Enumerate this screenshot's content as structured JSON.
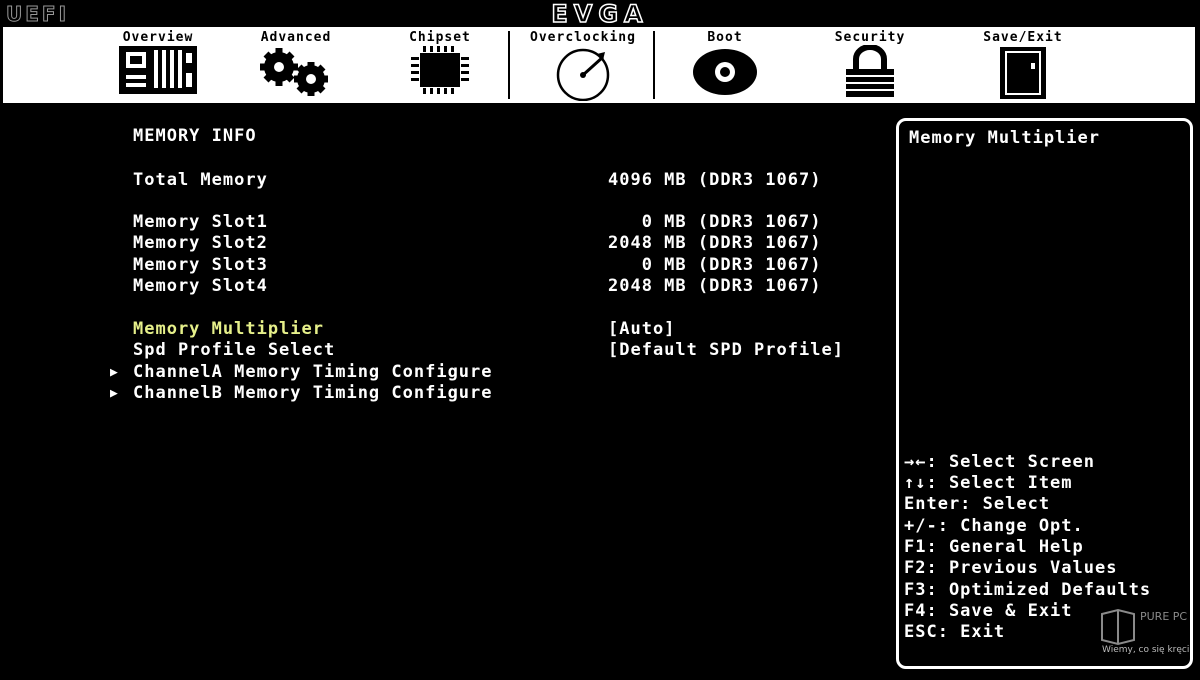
{
  "header": {
    "uefi_label": "UEFI",
    "brand": "EVGA"
  },
  "tabs": [
    {
      "label": "Overview",
      "icon": "motherboard-icon"
    },
    {
      "label": "Advanced",
      "icon": "gears-icon"
    },
    {
      "label": "Chipset",
      "icon": "chip-icon"
    },
    {
      "label": "Overclocking",
      "icon": "gauge-icon",
      "selected": true
    },
    {
      "label": "Boot",
      "icon": "disc-icon"
    },
    {
      "label": "Security",
      "icon": "padlock-icon"
    },
    {
      "label": "Save/Exit",
      "icon": "door-icon"
    }
  ],
  "main": {
    "section_title": "MEMORY INFO",
    "total_memory": {
      "label": "Total Memory",
      "value": "4096 MB (DDR3 1067)"
    },
    "slots": [
      {
        "label": "Memory Slot1",
        "value": "   0 MB (DDR3 1067)"
      },
      {
        "label": "Memory Slot2",
        "value": "2048 MB (DDR3 1067)"
      },
      {
        "label": "Memory Slot3",
        "value": "   0 MB (DDR3 1067)"
      },
      {
        "label": "Memory Slot4",
        "value": "2048 MB (DDR3 1067)"
      }
    ],
    "options": [
      {
        "label": "Memory Multiplier",
        "value": "[Auto]"
      },
      {
        "label": "Spd Profile Select",
        "value": "[Default SPD Profile]"
      },
      {
        "label": "ChannelA Memory Timing Configure"
      },
      {
        "label": "ChannelB Memory Timing Configure"
      }
    ]
  },
  "help": {
    "title": "Memory Multiplier",
    "lines": [
      "→←: Select Screen",
      "↑↓: Select Item",
      "Enter: Select",
      "+/-: Change Opt.",
      "F1: General Help",
      "F2: Previous Values",
      "F3: Optimized Defaults",
      "F4: Save & Exit",
      "ESC: Exit"
    ]
  },
  "watermark": {
    "logo": "PURE PC",
    "tagline": "Wiemy, co się kręci"
  },
  "colors": {
    "highlight": "#e6f08a",
    "background": "#000000",
    "tabbar": "#ffffff"
  }
}
